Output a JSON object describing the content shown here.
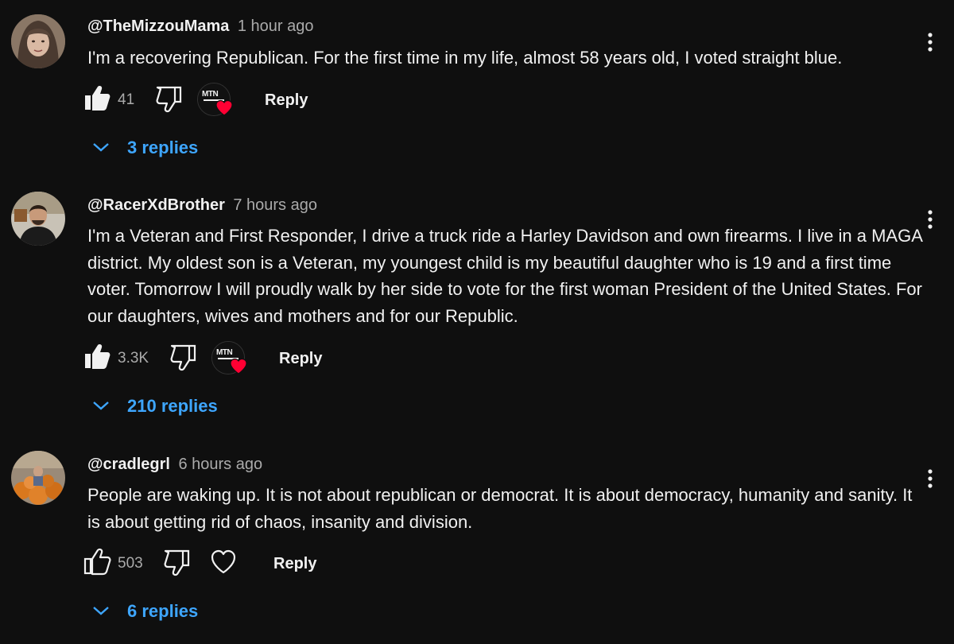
{
  "comments": [
    {
      "author": "@TheMizzouMama",
      "time": "1 hour ago",
      "text": "I'm a recovering Republican. For the first time in my life, almost 58 years old, I voted straight blue.",
      "likes": "41",
      "liked": true,
      "creator_heart": true,
      "creator_badge_text": "MTN",
      "reply_label": "Reply",
      "replies_label": "3 replies"
    },
    {
      "author": "@RacerXdBrother",
      "time": "7 hours ago",
      "text": "I'm a Veteran and First Responder, I drive a truck ride a Harley Davidson and own firearms. I live in a MAGA district. My oldest son is a Veteran, my youngest child is my beautiful daughter who is 19 and a first time voter. Tomorrow I will proudly walk by her side to vote for the first woman President of the United States. For our daughters, wives and mothers and for our Republic.",
      "likes": "3.3K",
      "liked": true,
      "creator_heart": true,
      "creator_badge_text": "MTN",
      "reply_label": "Reply",
      "replies_label": "210 replies"
    },
    {
      "author": "@cradlegrl",
      "time": "6 hours ago",
      "text": "People are waking up. It is not about republican or democrat. It is about democracy, humanity and sanity. It is about getting rid of chaos, insanity and division.",
      "likes": "503",
      "liked": false,
      "creator_heart": false,
      "reply_label": "Reply",
      "replies_label": "6 replies"
    }
  ],
  "icons": {
    "like": "thumbs-up-icon",
    "dislike": "thumbs-down-icon",
    "heart": "heart-icon",
    "more": "kebab-menu-icon",
    "expand": "chevron-down-icon"
  },
  "colors": {
    "background": "#0f0f0f",
    "text": "#f1f1f1",
    "secondary_text": "#aaaaaa",
    "link_blue": "#3ea6ff",
    "heart_red": "#ff0033"
  }
}
